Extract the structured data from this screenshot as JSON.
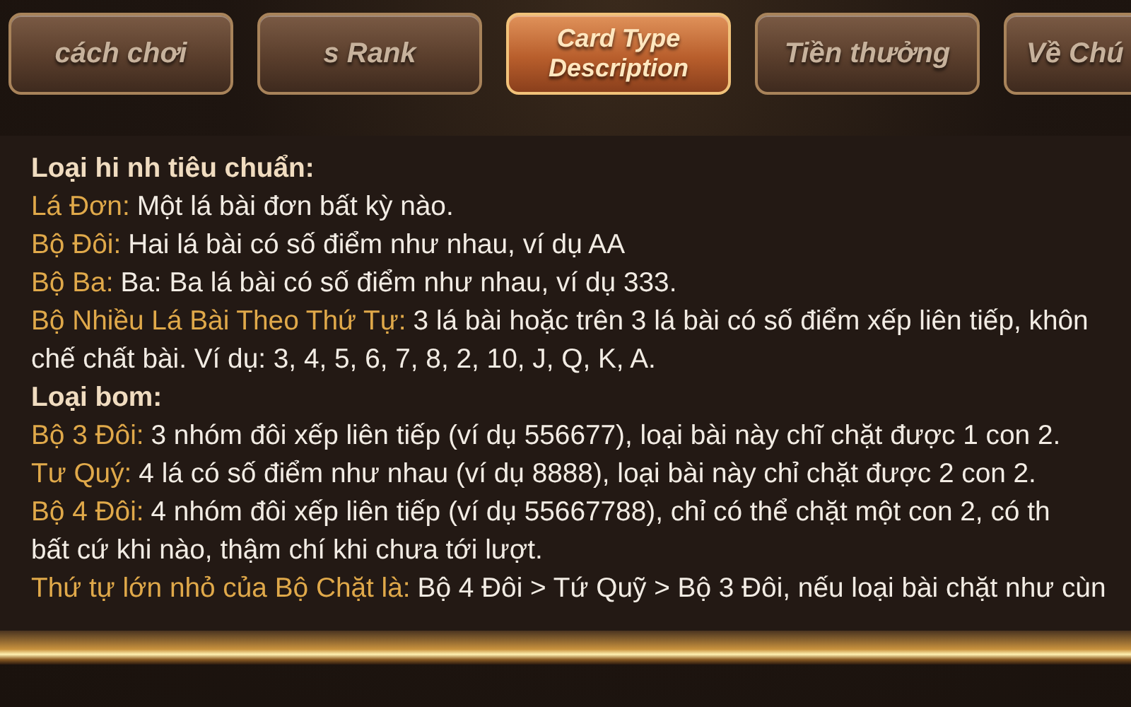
{
  "tabs": [
    {
      "label": "cách chơi",
      "selected": false
    },
    {
      "label": "s Rank",
      "selected": false
    },
    {
      "label": "Card Type Description",
      "selected": true
    },
    {
      "label": "Tiền thưởng",
      "selected": false
    },
    {
      "label": "Về Chú",
      "selected": false
    }
  ],
  "lines": [
    {
      "kind": "heading",
      "text": "Loại hi nh tiêu chuẩn:"
    },
    {
      "kind": "entry",
      "label": "Lá Đơn:",
      "text": "Một lá bài đơn bất kỳ nào."
    },
    {
      "kind": "entry",
      "label": "Bộ Đôi:",
      "text": "Hai lá bài có số điểm như nhau, ví dụ AA"
    },
    {
      "kind": "entry",
      "label": "Bộ Ba:",
      "text": "Ba: Ba lá bài có số điểm như nhau, ví dụ 333."
    },
    {
      "kind": "entry",
      "label": "Bộ Nhiều Lá Bài Theo Thứ Tự:",
      "text": "3 lá bài hoặc trên 3 lá bài có số điểm xếp liên tiếp, khôn"
    },
    {
      "kind": "continuation",
      "text": "chế chất bài. Ví dụ: 3, 4, 5, 6, 7, 8, 2, 10, J, Q, K, A."
    },
    {
      "kind": "heading",
      "text": "Loại bom:"
    },
    {
      "kind": "entry",
      "label": "Bộ 3 Đôi:",
      "text": "3 nhóm đôi xếp liên tiếp (ví dụ 556677), loại bài này chĩ chặt được 1 con 2."
    },
    {
      "kind": "entry",
      "label": "Tư Quý:",
      "text": "4 lá có số điểm như nhau (ví dụ 8888), loại bài này chỉ chặt được 2 con 2."
    },
    {
      "kind": "entry",
      "label": "Bộ 4 Đôi:",
      "text": "4 nhóm đôi xếp liên tiếp (ví dụ 55667788), chỉ có thể chặt một con 2, có th"
    },
    {
      "kind": "continuation",
      "text": "bất cứ khi nào, thậm chí khi chưa tới lượt."
    },
    {
      "kind": "entry",
      "label": "Thứ tự lớn nhỏ của Bộ Chặt là:",
      "text": "Bộ 4 Đôi > Tứ Quỹ > Bộ 3 Đôi, nếu loại bài chặt như cùn"
    }
  ]
}
